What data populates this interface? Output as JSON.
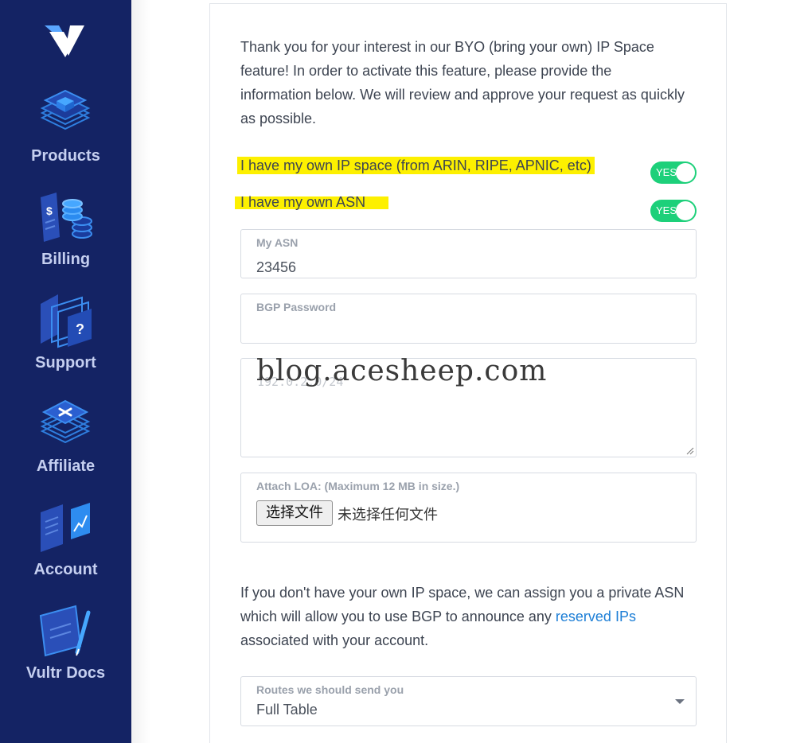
{
  "sidebar": {
    "items": [
      {
        "label": "Products",
        "icon": "products-icon"
      },
      {
        "label": "Billing",
        "icon": "billing-icon"
      },
      {
        "label": "Support",
        "icon": "support-icon"
      },
      {
        "label": "Affiliate",
        "icon": "affiliate-icon"
      },
      {
        "label": "Account",
        "icon": "account-icon"
      },
      {
        "label": "Vultr Docs",
        "icon": "docs-icon"
      }
    ]
  },
  "intro": {
    "text": "Thank you for your interest in our BYO (bring your own) IP Space feature! In order to activate this feature, please provide the information below. We will review and approve your request as quickly as possible."
  },
  "toggles": {
    "own_ip": {
      "label": "I have my own IP space (from ARIN, RIPE, APNIC, etc)",
      "state": "YES"
    },
    "own_asn": {
      "label": "I have my own ASN",
      "state": "YES"
    }
  },
  "form": {
    "my_asn": {
      "label": "My ASN",
      "value": "23456"
    },
    "bgp_password": {
      "label": "BGP Password",
      "value": ""
    },
    "subnets": {
      "placeholder": "192.0.2.0/24"
    },
    "loa": {
      "label": "Attach LOA: (Maximum 12 MB in size.)",
      "button": "选择文件",
      "status": "未选择任何文件"
    },
    "routes": {
      "label": "Routes we should send you",
      "value": "Full Table"
    }
  },
  "para2": {
    "before": "If you don't have your own IP space, we can assign you a private ASN which will allow you to use BGP to announce any ",
    "link": "reserved IPs",
    "after": " associated with your account."
  },
  "watermark": "blog.acesheep.com",
  "colors": {
    "sidebar_bg": "#142364",
    "toggle_on": "#1dd07a",
    "highlight": "#fdf000",
    "link": "#1c7ed6"
  }
}
